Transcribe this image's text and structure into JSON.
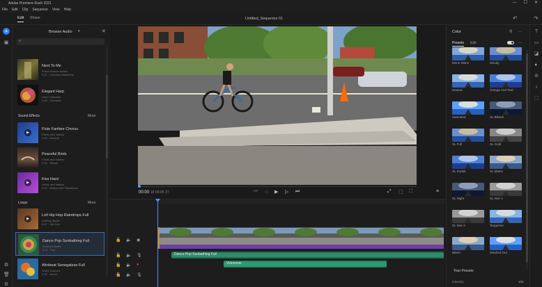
{
  "window": {
    "title": "Adobe Premiere Rush 2021",
    "controls": [
      "—",
      "☐",
      "✕"
    ]
  },
  "menu": [
    "File",
    "Edit",
    "Clip",
    "Sequence",
    "View",
    "Help"
  ],
  "tabs": {
    "edit": "Edit",
    "share": "Share"
  },
  "sequence_title": "Untitled_Sequence 01",
  "audio_panel": {
    "title": "Browse Audio",
    "tracks_top": [
      {
        "name": "Next To Me",
        "sub1": "Proud Human Remix",
        "sub2": "3:11 · Courtney Ballantine"
      },
      {
        "name": "Elegant Harp",
        "sub1": "Harp Collection",
        "sub2": "2:26 · Classical"
      }
    ],
    "sound_effects": {
      "heading": "Sound Effects",
      "more": "More",
      "items": [
        {
          "name": "Flute Fanfare Chorus",
          "sub1": "Fields and Valleys",
          "sub2": "0:03 · Musical"
        },
        {
          "name": "Peaceful Birds",
          "sub1": "Fields and Valleys",
          "sub2": "0:10 · Nature"
        },
        {
          "name": "Kiss Hard",
          "sub1": "Fields and Valleys",
          "sub2": "0:10 · Motion And Transitions"
        }
      ]
    },
    "loops": {
      "heading": "Loops",
      "more": "More",
      "items": [
        {
          "name": "Lofi Hip Hop Raindrops Full",
          "sub1": "Chillhop Beats",
          "sub2": "0:27 · Hip Hop"
        },
        {
          "name": "Dance Pop Sunbathing Full",
          "sub1": "Summer Beats",
          "sub2": "0:21 · Pop"
        },
        {
          "name": "Afrobeat Senegalese Full",
          "sub1": "World Grooves",
          "sub2": "0:29 · World"
        }
      ]
    }
  },
  "transport": {
    "timecode": "00:00",
    "timecode_frames": "18",
    "duration": "00:05",
    "duration_frames": "27"
  },
  "timeline": {
    "clip_audio1_label": "Dance Pop Sunbathing Full",
    "clip_audio2_label": "Voiceover"
  },
  "color_panel": {
    "title": "Color",
    "tab_presets": "Presets",
    "tab_edit": "Edit",
    "presets": [
      {
        "left": "Mono Warm",
        "right": "Moody"
      },
      {
        "left": "Neutral",
        "right": "Orange And Teal"
      },
      {
        "left": "Saturated",
        "right": "SL Bleach"
      },
      {
        "left": "SL Full",
        "right": "SL Gold"
      },
      {
        "left": "SL Kodak",
        "right": "SL Matrix"
      },
      {
        "left": "SL Night",
        "right": "SL Noir 1"
      },
      {
        "left": "SL Noir 2",
        "right": "Tangerine"
      },
      {
        "left": "Warm",
        "right": "Washed Out"
      }
    ],
    "your_presets": "Your Presets",
    "intensity_label": "Intensity",
    "intensity_value": "100"
  },
  "colors": {
    "accent": "#2d7cf6",
    "playhead": "#4a90ff",
    "audio_clip": "#1f6e52",
    "purple_track": "#6f3fa8"
  }
}
